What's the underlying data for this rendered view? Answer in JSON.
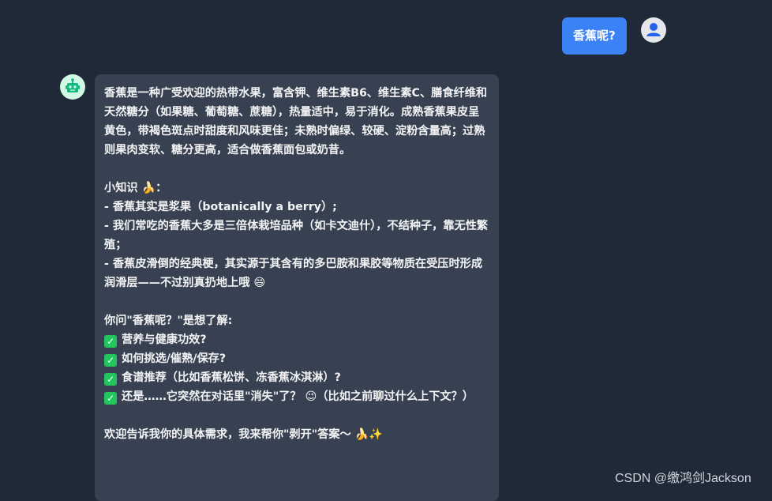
{
  "user_message": "香蕉呢?",
  "bot_message": {
    "intro": "香蕉是一种广受欢迎的热带水果，富含钾、维生素B6、维生素C、膳食纤维和天然糖分（如果糖、葡萄糖、蔗糖），热量适中，易于消化。成熟香蕉果皮呈黄色，带褐色斑点时甜度和风味更佳；未熟时偏绿、较硬、淀粉含量高；过熟则果肉变软、糖分更高，适合做香蕉面包或奶昔。",
    "trivia_title": "小知识 🍌：",
    "trivia_1": "- 香蕉其实是浆果（botanically a berry）;",
    "trivia_2": "- 我们常吃的香蕉大多是三倍体栽培品种（如卡文迪什），不结种子，靠无性繁殖；",
    "trivia_3": "- 香蕉皮滑倒的经典梗，其实源于其含有的多巴胺和果胶等物质在受压时形成润滑层——不过别真扔地上哦 😄",
    "question_intro": "你问\"香蕉呢？\"是想了解:",
    "options": [
      "营养与健康功效?",
      "如何挑选/催熟/保存?",
      "食谱推荐（比如香蕉松饼、冻香蕉冰淇淋）?",
      "还是……它突然在对话里\"消失\"了？ 😉（比如之前聊过什么上下文？）"
    ],
    "outro": "欢迎告诉我你的具体需求，我来帮你\"剥开\"答案～ 🍌✨"
  },
  "watermark": "CSDN @缴鸿剑Jackson",
  "icons": {
    "user_avatar": "user-icon",
    "bot_avatar": "robot-icon",
    "check": "check-icon"
  },
  "colors": {
    "background": "#1f2937",
    "user_bubble": "#3b82f6",
    "bot_bubble": "#374151",
    "check": "#22c55e"
  }
}
